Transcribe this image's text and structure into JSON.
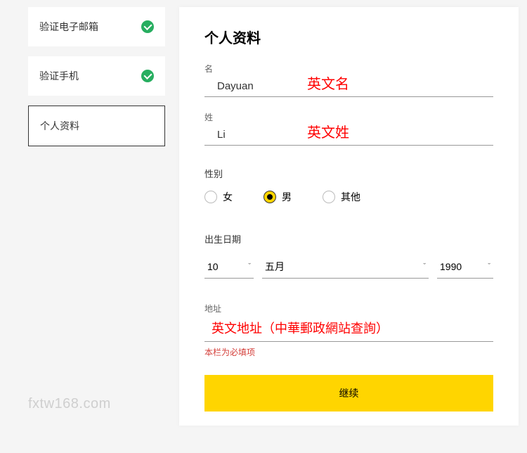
{
  "sidebar": {
    "steps": [
      {
        "label": "验证电子邮箱",
        "done": true
      },
      {
        "label": "验证手机",
        "done": true
      },
      {
        "label": "个人资料",
        "active": true
      }
    ]
  },
  "main": {
    "title": "个人资料",
    "first_name": {
      "label": "名",
      "value": "Dayuan",
      "annotation": "英文名"
    },
    "last_name": {
      "label": "姓",
      "value": "Li",
      "annotation": "英文姓"
    },
    "gender": {
      "label": "性别",
      "options": [
        {
          "label": "女",
          "selected": false
        },
        {
          "label": "男",
          "selected": true
        },
        {
          "label": "其他",
          "selected": false
        }
      ]
    },
    "dob": {
      "label": "出生日期",
      "day": "10",
      "month": "五月",
      "year": "1990"
    },
    "address": {
      "label": "地址",
      "annotation": "英文地址（中華郵政網站查詢）",
      "error": "本栏为必填项"
    },
    "submit_label": "继续"
  },
  "watermark": "fxtw168.com"
}
